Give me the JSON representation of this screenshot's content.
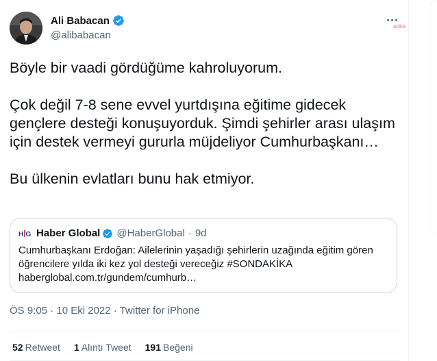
{
  "author": {
    "name": "Ali Babacan",
    "handle": "@alibabacan",
    "avatar_icon": "profile-photo",
    "verified_icon": "verified-badge-icon"
  },
  "watermark": "anka",
  "tweet": {
    "paragraphs": [
      "Böyle bir vaadi gördüğüme kahroluyorum.",
      "Çok değil 7-8 sene evvel yurtdışına eğitime gidecek gençlere desteği konuşuyorduk. Şimdi şehirler arası ulaşım için destek vermeyi gururla müjdeliyor Cumhurbaşkanı…",
      "Bu ülkenin evlatları bunu hak etmiyor."
    ]
  },
  "quote": {
    "logo_icon": "haber-global-logo",
    "name": "Haber Global",
    "handle": "@HaberGlobal",
    "separator": "·",
    "time": "9d",
    "text_lines": [
      "Cumhurbaşkanı Erdoğan: Ailelerinin yaşadığı şehirlerin uzağında eğitim gören",
      "öğrencilere yılda iki kez yol desteği vereceğiz #SONDAKİKA",
      "haberglobal.com.tr/gundem/cumhurb…"
    ]
  },
  "meta": {
    "time": "ÖS 9:05",
    "separator1": "·",
    "date": "10 Eki 2022",
    "separator2": "·",
    "source": "Twitter for iPhone"
  },
  "stats": {
    "retweets_count": "52",
    "retweets_label": "Retweet",
    "quotes_count": "1",
    "quotes_label": "Alıntı Tweet",
    "likes_count": "191",
    "likes_label": "Beğeni"
  },
  "colors": {
    "verified": "#1d9bf0",
    "text": "#0f1419",
    "secondary": "#536471",
    "border": "#cfd9de"
  }
}
